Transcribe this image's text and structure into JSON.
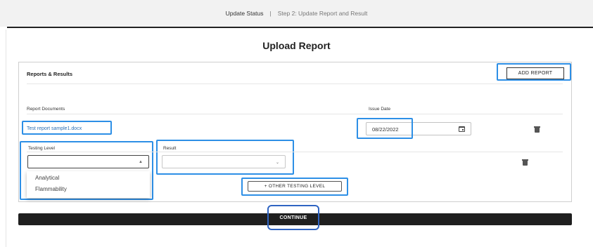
{
  "breadcrumb": {
    "step1": "Update Status",
    "separator": "|",
    "step2": "Step 2: Update Report and Result"
  },
  "page": {
    "title": "Upload Report"
  },
  "reports": {
    "section_title": "Reports & Results",
    "add_report_label": "ADD REPORT",
    "documents_label": "Report Documents",
    "issue_date_label": "Issue Date",
    "file_name": "Test report sample1.docx",
    "issue_date": "08/22/2022",
    "icons": {
      "calendar": "calendar-icon",
      "delete": "trash-icon",
      "dropdown": "chevron-icon"
    }
  },
  "testing": {
    "testing_level_label": "Testing Level",
    "testing_level_value": "",
    "result_label": "Result",
    "result_value": "",
    "options": [
      "Analytical",
      "Flammability"
    ],
    "other_testing_label": "+ OTHER TESTING LEVEL"
  },
  "actions": {
    "continue_label": "CONTINUE"
  },
  "colors": {
    "highlight": "#2d8fe6",
    "continue_highlight": "#2f64c2",
    "link": "#2a6fb5",
    "continue_bar": "#1f1f1f"
  }
}
